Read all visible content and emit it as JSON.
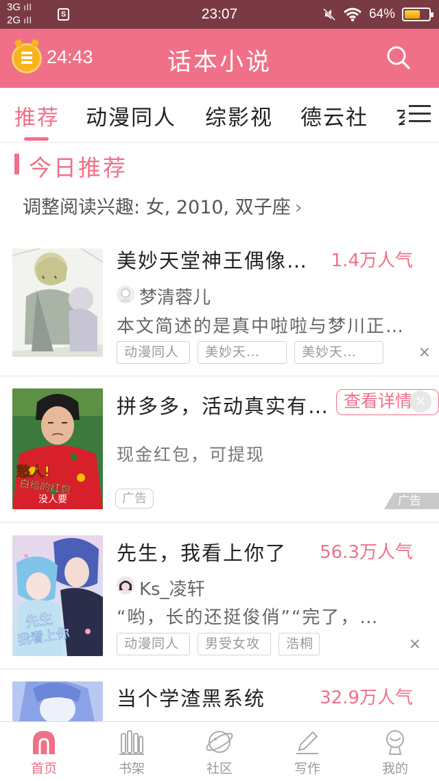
{
  "status_bar": {
    "network_top": "3G",
    "network_bottom": "2G",
    "signal_glyph": "ıll",
    "time": "23:07",
    "battery": "64%",
    "battery_level": 0.64,
    "icons": [
      "sim-icon",
      "mute-icon",
      "wifi-icon",
      "battery-icon"
    ]
  },
  "header": {
    "timer": "24:43",
    "title": "话本小说",
    "accent": "#f07088"
  },
  "tabs": [
    {
      "label": "推荐"
    },
    {
      "label": "动漫同人"
    },
    {
      "label": "综影视"
    },
    {
      "label": "德云社"
    },
    {
      "label": "玄"
    }
  ],
  "section": {
    "title": "今日推荐",
    "interest": "调整阅读兴趣: 女, 2010, 双子座",
    "chevron": "›"
  },
  "feed": [
    {
      "title": "美妙天堂神王偶像…",
      "popularity": "1.4万人气",
      "author": "梦清蓉儿",
      "description": "本文简述的是真中啦啦与梦川正…",
      "tags": [
        "动漫同人",
        "美妙天…",
        "美妙天…"
      ],
      "close": "×"
    },
    {
      "title": "先生，我看上你了",
      "popularity": "56.3万人气",
      "author": "Ks_凌轩",
      "description": "“哟，长的还挺俊俏”“完了，…",
      "tags": [
        "动漫同人",
        "男受女攻",
        "浩桐"
      ],
      "close": "×"
    },
    {
      "title": "当个学渣黑系统",
      "popularity": "32.9万人气"
    }
  ],
  "ad": {
    "title": "拼多多，活动真实有…",
    "button": "查看详情",
    "subtitle": "现金红包，可提现",
    "badge": "广告",
    "corner_label": "广告",
    "close": "×",
    "image_caption_1": "愁人!",
    "image_caption_2": "白给的红包",
    "image_caption_3": "没人要"
  },
  "cover_text": {
    "line1": "先生",
    "line2": "我看上你"
  },
  "bottom_nav": [
    {
      "label": "首页",
      "icon": "home-icon",
      "active": true
    },
    {
      "label": "书架",
      "icon": "bookshelf-icon"
    },
    {
      "label": "社区",
      "icon": "planet-icon"
    },
    {
      "label": "写作",
      "icon": "pen-icon"
    },
    {
      "label": "我的",
      "icon": "profile-icon"
    }
  ]
}
